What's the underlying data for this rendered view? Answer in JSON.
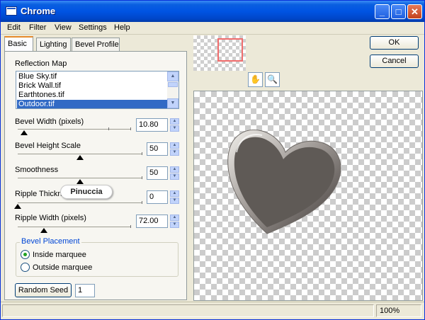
{
  "window": {
    "title": "Chrome"
  },
  "menu": [
    "Edit",
    "Filter",
    "View",
    "Settings",
    "Help"
  ],
  "tabs": {
    "basic": "Basic",
    "lighting": "Lighting",
    "bevel_profile": "Bevel Profile"
  },
  "reflection": {
    "label": "Reflection Map",
    "items": [
      "Blue Sky.tif",
      "Brick Wall.tif",
      "Earthtones.tif",
      "Outdoor.tif"
    ],
    "selected": "Outdoor.tif"
  },
  "sliders": {
    "bevel_width": {
      "label": "Bevel Width (pixels)",
      "value": "10.80"
    },
    "bevel_height": {
      "label": "Bevel Height Scale",
      "value": "50"
    },
    "smoothness": {
      "label": "Smoothness",
      "value": "50"
    },
    "ripple_thickness": {
      "label": "Ripple Thickne",
      "value": "0"
    },
    "ripple_width": {
      "label": "Ripple Width (pixels)",
      "value": "72.00"
    }
  },
  "watermark": "Pinuccia",
  "bevel_placement": {
    "title": "Bevel Placement",
    "inside": "Inside marquee",
    "outside": "Outside marquee",
    "selected": "inside"
  },
  "random_seed": {
    "button": "Random Seed",
    "value": "1"
  },
  "buttons": {
    "ok": "OK",
    "cancel": "Cancel"
  },
  "tools": {
    "hand": "hand-icon",
    "zoom": "magnifier-icon"
  },
  "status": {
    "zoom": "100%"
  },
  "colors": {
    "title_bar": "#0054e3",
    "selection": "#316ac5",
    "heart": "#5f5a56",
    "nav_rect": "#f06d6d"
  }
}
